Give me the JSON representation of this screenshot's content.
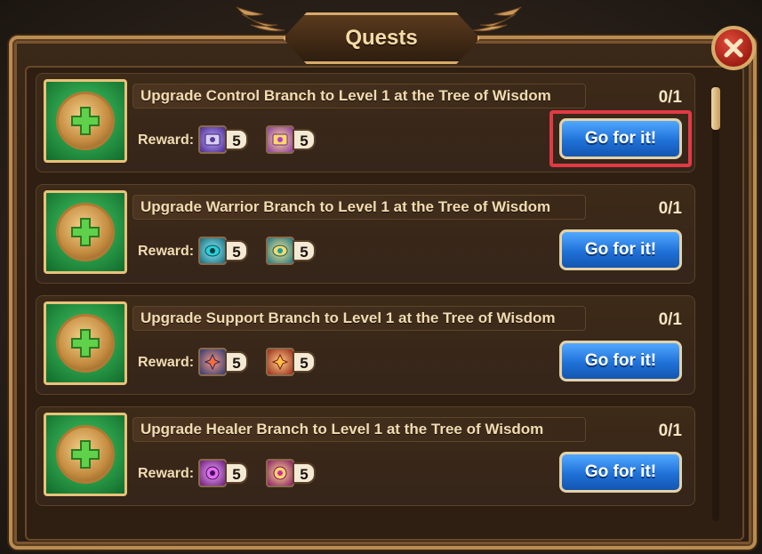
{
  "window": {
    "title": "Quests"
  },
  "colors": {
    "accent": "#1f71d8",
    "highlight": "#e23a45",
    "frame": "#b98c52"
  },
  "quests": [
    {
      "title": "Upgrade Control Branch to Level 1 at the Tree of Wisdom",
      "progress": "0/1",
      "reward_label": "Reward:",
      "rewards": [
        {
          "icon": "control-rune-purple-icon",
          "count": "5"
        },
        {
          "icon": "control-rune-gold-icon",
          "count": "5"
        }
      ],
      "button": "Go for it!"
    },
    {
      "title": "Upgrade Warrior Branch to Level 1 at the Tree of Wisdom",
      "progress": "0/1",
      "reward_label": "Reward:",
      "rewards": [
        {
          "icon": "warrior-rune-teal-icon",
          "count": "5"
        },
        {
          "icon": "warrior-rune-gold-icon",
          "count": "5"
        }
      ],
      "button": "Go for it!"
    },
    {
      "title": "Upgrade Support Branch to Level 1 at the Tree of Wisdom",
      "progress": "0/1",
      "reward_label": "Reward:",
      "rewards": [
        {
          "icon": "support-rune-blue-icon",
          "count": "5"
        },
        {
          "icon": "support-rune-red-icon",
          "count": "5"
        }
      ],
      "button": "Go for it!"
    },
    {
      "title": "Upgrade Healer Branch to Level 1 at the Tree of Wisdom",
      "progress": "0/1",
      "reward_label": "Reward:",
      "rewards": [
        {
          "icon": "healer-rune-purple-icon",
          "count": "5"
        },
        {
          "icon": "healer-rune-gold-icon",
          "count": "5"
        }
      ],
      "button": "Go for it!"
    }
  ]
}
